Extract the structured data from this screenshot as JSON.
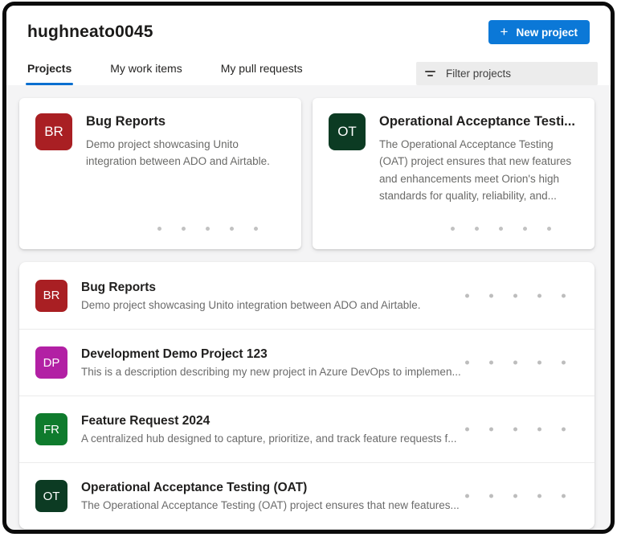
{
  "header": {
    "title": "hughneato0045",
    "new_project_button": {
      "label": "New project",
      "plus_glyph": "+"
    },
    "tabs": [
      {
        "label": "Projects",
        "active": true
      },
      {
        "label": "My work items",
        "active": false
      },
      {
        "label": "My pull requests",
        "active": false
      }
    ],
    "filter": {
      "placeholder": "Filter projects"
    }
  },
  "colors": {
    "accent_blue": "#0B78D7",
    "tab_underline": "#0B6FD0",
    "page_background": "#F4F4F5",
    "avatar_red": "#A91F23",
    "avatar_magenta": "#B220A4",
    "avatar_green": "#0F7B2D",
    "avatar_dark_green": "#0C3B23"
  },
  "cards": [
    {
      "initials": "BR",
      "color": "#A91F23",
      "title": "Bug Reports",
      "description": "Demo project showcasing Unito integration between ADO and Airtable."
    },
    {
      "initials": "OT",
      "color": "#0C3B23",
      "title": "Operational Acceptance Testi...",
      "description": "The Operational Acceptance Testing (OAT) project ensures that new features and enhancements meet Orion's high standards for quality, reliability, and..."
    }
  ],
  "rows": [
    {
      "initials": "BR",
      "color": "#A91F23",
      "title": "Bug Reports",
      "description": "Demo project showcasing Unito integration between ADO and Airtable."
    },
    {
      "initials": "DP",
      "color": "#B220A4",
      "title": "Development Demo Project 123",
      "description": "This is a description describing my new project in Azure DevOps to implemen..."
    },
    {
      "initials": "FR",
      "color": "#0F7B2D",
      "title": "Feature Request 2024",
      "description": "A centralized hub designed to capture, prioritize, and track feature requests f..."
    },
    {
      "initials": "OT",
      "color": "#0C3B23",
      "title": "Operational Acceptance Testing (OAT)",
      "description": "The Operational Acceptance Testing (OAT) project ensures that new features..."
    }
  ]
}
